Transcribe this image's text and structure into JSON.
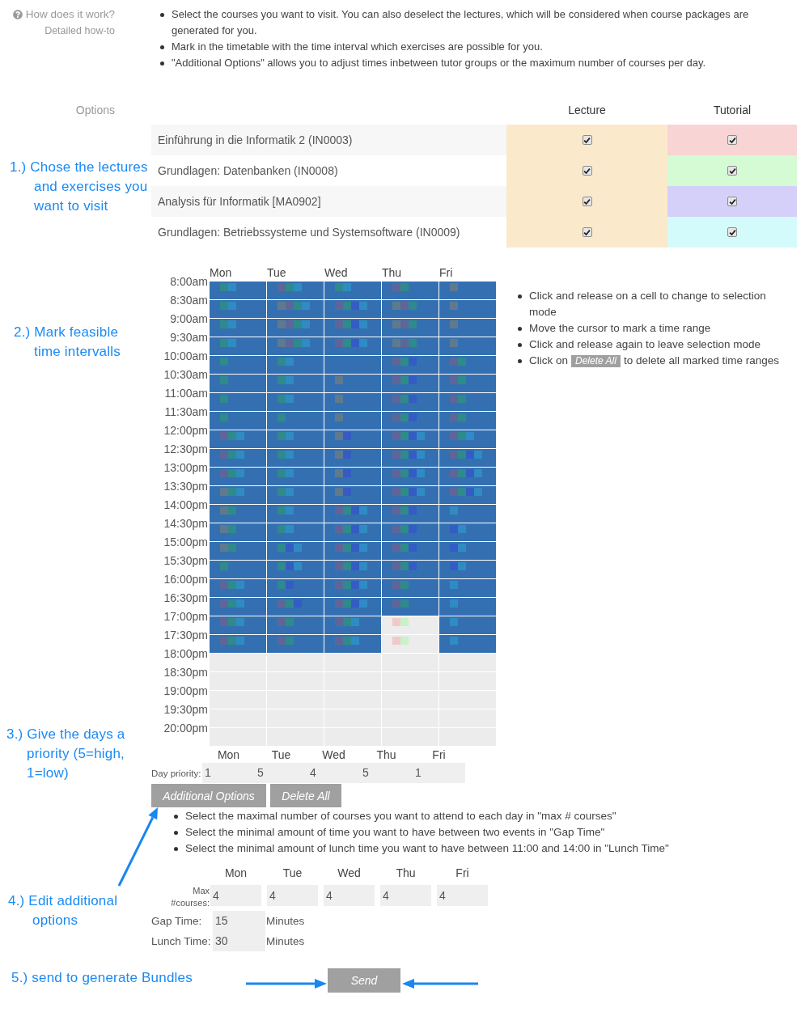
{
  "help": {
    "title": "How does it work?",
    "link": "Detailed how-to",
    "steps": [
      "Select the courses you want to visit. You can also deselect the lectures, which will be considered when course packages are generated for you.",
      "Mark in the timetable with the time interval which exercises are possible for you.",
      "\"Additional Options\" allows you to adjust times inbetween tutor groups or the maximum number of courses per day."
    ]
  },
  "courses": {
    "label": "Options",
    "annotation": "1.) Chose the lectures\nand exercises you\nwant to visit",
    "columns": [
      "Lecture",
      "Tutorial"
    ],
    "rows": [
      {
        "name": "Einführung in die Informatik 2 (IN0003)",
        "lecture": {
          "checked": true
        },
        "tutorial": {
          "checked": true,
          "color": "#f9d4d4"
        }
      },
      {
        "name": "Grundlagen: Datenbanken (IN0008)",
        "lecture": {
          "checked": true
        },
        "tutorial": {
          "checked": true,
          "color": "#d4fbd4"
        }
      },
      {
        "name": "Analysis für Informatik [MA0902]",
        "lecture": {
          "checked": true
        },
        "tutorial": {
          "checked": true,
          "color": "#d4d0fa"
        }
      },
      {
        "name": "Grundlagen: Betriebssysteme und Systemsoftware (IN0009)",
        "lecture": {
          "checked": true
        },
        "tutorial": {
          "checked": true,
          "color": "#d4fbfb"
        }
      }
    ]
  },
  "timetable": {
    "annotation": "2.) Mark feasible\ntime intervalls",
    "days": [
      "Mon",
      "Tue",
      "Wed",
      "Thu",
      "Fri"
    ],
    "rows": [
      {
        "time": "8:00am",
        "cells": [
          {
            "marked": true,
            "markers": [
              {
                "color": "#2e8a8b"
              },
              {
                "color": "#2f8bc3"
              }
            ]
          },
          {
            "marked": true,
            "markers": [
              {
                "color": "#5e6699"
              },
              {
                "color": "#2e8a8b"
              },
              {
                "color": "#2f8bc3"
              }
            ]
          },
          {
            "marked": true,
            "markers": [
              {
                "color": "#2e8a8b"
              },
              {
                "color": "#2f8bc3"
              }
            ]
          },
          {
            "marked": true,
            "markers": [
              {
                "color": "#5e6699"
              },
              {
                "color": "#2e8a8b"
              }
            ]
          },
          {
            "marked": true,
            "markers": [
              {
                "color": "#5f7a8e"
              }
            ]
          }
        ]
      },
      {
        "time": "8:30am",
        "cells": [
          {
            "marked": true,
            "markers": [
              {
                "color": "#2e8a8b"
              },
              {
                "color": "#2f8bc3"
              }
            ]
          },
          {
            "marked": true,
            "markers": [
              {
                "color": "#5f7a8e"
              },
              {
                "color": "#5e6699"
              },
              {
                "color": "#2e8a8b"
              },
              {
                "color": "#2f8bc3"
              }
            ]
          },
          {
            "marked": true,
            "markers": [
              {
                "color": "#5e6699"
              },
              {
                "color": "#2e8a8b"
              },
              {
                "color": "#345cc4"
              },
              {
                "color": "#2f8bc3"
              }
            ]
          },
          {
            "marked": true,
            "markers": [
              {
                "color": "#5f7a8e"
              },
              {
                "color": "#5e6699"
              },
              {
                "color": "#2e8a8b"
              }
            ]
          },
          {
            "marked": true,
            "markers": [
              {
                "color": "#5f7a8e"
              }
            ]
          }
        ]
      },
      {
        "time": "9:00am",
        "cells": [
          {
            "marked": true,
            "markers": [
              {
                "color": "#2e8a8b"
              },
              {
                "color": "#2f8bc3"
              }
            ]
          },
          {
            "marked": true,
            "markers": [
              {
                "color": "#5f7a8e"
              },
              {
                "color": "#5e6699"
              },
              {
                "color": "#2e8a8b"
              },
              {
                "color": "#2f8bc3"
              }
            ]
          },
          {
            "marked": true,
            "markers": [
              {
                "color": "#5e6699"
              },
              {
                "color": "#2e8a8b"
              },
              {
                "color": "#345cc4"
              },
              {
                "color": "#2f8bc3"
              }
            ]
          },
          {
            "marked": true,
            "markers": [
              {
                "color": "#5f7a8e"
              },
              {
                "color": "#5e6699"
              },
              {
                "color": "#2e8a8b"
              }
            ]
          },
          {
            "marked": true,
            "markers": [
              {
                "color": "#5f7a8e"
              }
            ]
          }
        ]
      },
      {
        "time": "9:30am",
        "cells": [
          {
            "marked": true,
            "markers": [
              {
                "color": "#2e8a8b"
              },
              {
                "color": "#2f8bc3"
              }
            ]
          },
          {
            "marked": true,
            "markers": [
              {
                "color": "#5f7a8e"
              },
              {
                "color": "#5e6699"
              },
              {
                "color": "#2e8a8b"
              },
              {
                "color": "#2f8bc3"
              }
            ]
          },
          {
            "marked": true,
            "markers": [
              {
                "color": "#5e6699"
              },
              {
                "color": "#2e8a8b"
              },
              {
                "color": "#345cc4"
              },
              {
                "color": "#2f8bc3"
              }
            ]
          },
          {
            "marked": true,
            "markers": [
              {
                "color": "#5f7a8e"
              },
              {
                "color": "#5e6699"
              },
              {
                "color": "#2e8a8b"
              }
            ]
          },
          {
            "marked": true,
            "markers": [
              {
                "color": "#5f7a8e"
              }
            ]
          }
        ]
      },
      {
        "time": "10:00am",
        "cells": [
          {
            "marked": true,
            "markers": [
              {
                "color": "#2e8a8b"
              }
            ]
          },
          {
            "marked": true,
            "markers": [
              {
                "color": "#2e8a8b"
              },
              {
                "color": "#2f8bc3"
              }
            ]
          },
          {
            "marked": true
          },
          {
            "marked": true,
            "markers": [
              {
                "color": "#5e6699"
              },
              {
                "color": "#2e8a8b"
              },
              {
                "color": "#345cc4"
              }
            ]
          },
          {
            "marked": true,
            "markers": [
              {
                "color": "#5e6699"
              },
              {
                "color": "#2e8a8b"
              }
            ]
          }
        ]
      },
      {
        "time": "10:30am",
        "cells": [
          {
            "marked": true,
            "markers": [
              {
                "color": "#2e8a8b"
              }
            ]
          },
          {
            "marked": true,
            "markers": [
              {
                "color": "#2e8a8b"
              },
              {
                "color": "#2f8bc3"
              }
            ]
          },
          {
            "marked": true,
            "markers": [
              {
                "color": "#5f7a8e"
              }
            ]
          },
          {
            "marked": true,
            "markers": [
              {
                "color": "#5e6699"
              },
              {
                "color": "#2e8a8b"
              },
              {
                "color": "#345cc4"
              }
            ]
          },
          {
            "marked": true,
            "markers": [
              {
                "color": "#5e6699"
              },
              {
                "color": "#2e8a8b"
              }
            ]
          }
        ]
      },
      {
        "time": "11:00am",
        "cells": [
          {
            "marked": true,
            "markers": [
              {
                "color": "#2e8a8b"
              }
            ]
          },
          {
            "marked": true,
            "markers": [
              {
                "color": "#2e8a8b"
              },
              {
                "color": "#2f8bc3"
              }
            ]
          },
          {
            "marked": true,
            "markers": [
              {
                "color": "#5f7a8e"
              }
            ]
          },
          {
            "marked": true,
            "markers": [
              {
                "color": "#5e6699"
              },
              {
                "color": "#2e8a8b"
              },
              {
                "color": "#345cc4"
              }
            ]
          },
          {
            "marked": true,
            "markers": [
              {
                "color": "#5e6699"
              },
              {
                "color": "#2e8a8b"
              }
            ]
          }
        ]
      },
      {
        "time": "11:30am",
        "cells": [
          {
            "marked": true,
            "markers": [
              {
                "color": "#2e8a8b"
              }
            ]
          },
          {
            "marked": true,
            "markers": [
              {
                "color": "#2e8a8b"
              }
            ]
          },
          {
            "marked": true,
            "markers": [
              {
                "color": "#5f7a8e"
              }
            ]
          },
          {
            "marked": true,
            "markers": [
              {
                "color": "#5e6699"
              },
              {
                "color": "#2e8a8b"
              },
              {
                "color": "#345cc4"
              }
            ]
          },
          {
            "marked": true,
            "markers": [
              {
                "color": "#5e6699"
              },
              {
                "color": "#2e8a8b"
              }
            ]
          }
        ]
      },
      {
        "time": "12:00pm",
        "cells": [
          {
            "marked": true,
            "markers": [
              {
                "color": "#5e6699"
              },
              {
                "color": "#2e8a8b"
              },
              {
                "color": "#2f8bc3"
              }
            ]
          },
          {
            "marked": true,
            "markers": [
              {
                "color": "#2e8a8b"
              },
              {
                "color": "#2f8bc3"
              }
            ]
          },
          {
            "marked": true,
            "markers": [
              {
                "color": "#5f7a8e"
              },
              {
                "color": "#345cc4"
              }
            ]
          },
          {
            "marked": true,
            "markers": [
              {
                "color": "#5e6699"
              },
              {
                "color": "#2e8a8b"
              },
              {
                "color": "#345cc4"
              },
              {
                "color": "#2f8bc3"
              }
            ]
          },
          {
            "marked": true,
            "markers": [
              {
                "color": "#5e6699"
              },
              {
                "color": "#2e8a8b"
              },
              {
                "color": "#2f8bc3"
              }
            ]
          }
        ]
      },
      {
        "time": "12:30pm",
        "cells": [
          {
            "marked": true,
            "markers": [
              {
                "color": "#5e6699"
              },
              {
                "color": "#2e8a8b"
              },
              {
                "color": "#2f8bc3"
              }
            ]
          },
          {
            "marked": true,
            "markers": [
              {
                "color": "#2e8a8b"
              },
              {
                "color": "#2f8bc3"
              }
            ]
          },
          {
            "marked": true,
            "markers": [
              {
                "color": "#5f7a8e"
              },
              {
                "color": "#345cc4"
              }
            ]
          },
          {
            "marked": true,
            "markers": [
              {
                "color": "#5e6699"
              },
              {
                "color": "#2e8a8b"
              },
              {
                "color": "#345cc4"
              },
              {
                "color": "#2f8bc3"
              }
            ]
          },
          {
            "marked": true,
            "markers": [
              {
                "color": "#5e6699"
              },
              {
                "color": "#2e8a8b"
              },
              {
                "color": "#345cc4"
              },
              {
                "color": "#2f8bc3"
              }
            ]
          }
        ]
      },
      {
        "time": "13:00pm",
        "cells": [
          {
            "marked": true,
            "markers": [
              {
                "color": "#5e6699"
              },
              {
                "color": "#2e8a8b"
              },
              {
                "color": "#2f8bc3"
              }
            ]
          },
          {
            "marked": true,
            "markers": [
              {
                "color": "#2e8a8b"
              },
              {
                "color": "#2f8bc3"
              }
            ]
          },
          {
            "marked": true,
            "markers": [
              {
                "color": "#5f7a8e"
              },
              {
                "color": "#345cc4"
              }
            ]
          },
          {
            "marked": true,
            "markers": [
              {
                "color": "#5e6699"
              },
              {
                "color": "#2e8a8b"
              },
              {
                "color": "#345cc4"
              },
              {
                "color": "#2f8bc3"
              }
            ]
          },
          {
            "marked": true,
            "markers": [
              {
                "color": "#5e6699"
              },
              {
                "color": "#2e8a8b"
              },
              {
                "color": "#345cc4"
              },
              {
                "color": "#2f8bc3"
              }
            ]
          }
        ]
      },
      {
        "time": "13:30pm",
        "cells": [
          {
            "marked": true,
            "markers": [
              {
                "color": "#5f7a8e"
              },
              {
                "color": "#2e8a8b"
              },
              {
                "color": "#2f8bc3"
              }
            ]
          },
          {
            "marked": true,
            "markers": [
              {
                "color": "#2e8a8b"
              },
              {
                "color": "#2f8bc3"
              }
            ]
          },
          {
            "marked": true,
            "markers": [
              {
                "color": "#5f7a8e"
              },
              {
                "color": "#345cc4"
              }
            ]
          },
          {
            "marked": true,
            "markers": [
              {
                "color": "#5e6699"
              },
              {
                "color": "#2e8a8b"
              },
              {
                "color": "#345cc4"
              },
              {
                "color": "#2f8bc3"
              }
            ]
          },
          {
            "marked": true,
            "markers": [
              {
                "color": "#5e6699"
              },
              {
                "color": "#2e8a8b"
              },
              {
                "color": "#345cc4"
              },
              {
                "color": "#2f8bc3"
              }
            ]
          }
        ]
      },
      {
        "time": "14:00pm",
        "cells": [
          {
            "marked": true,
            "markers": [
              {
                "color": "#5f7a8e"
              },
              {
                "color": "#2e8a8b"
              }
            ]
          },
          {
            "marked": true,
            "markers": [
              {
                "color": "#2e8a8b"
              },
              {
                "color": "#2f8bc3"
              }
            ]
          },
          {
            "marked": true,
            "markers": [
              {
                "color": "#5e6699"
              },
              {
                "color": "#2e8a8b"
              },
              {
                "color": "#345cc4"
              },
              {
                "color": "#2f8bc3"
              }
            ]
          },
          {
            "marked": true,
            "markers": [
              {
                "color": "#5e6699"
              },
              {
                "color": "#2e8a8b"
              },
              {
                "color": "#345cc4"
              }
            ]
          },
          {
            "marked": true,
            "markers": [
              {
                "color": "#2f8bc3"
              }
            ]
          }
        ]
      },
      {
        "time": "14:30pm",
        "cells": [
          {
            "marked": true,
            "markers": [
              {
                "color": "#5f7a8e"
              },
              {
                "color": "#2e8a8b"
              }
            ]
          },
          {
            "marked": true,
            "markers": [
              {
                "color": "#2e8a8b"
              },
              {
                "color": "#2f8bc3"
              }
            ]
          },
          {
            "marked": true,
            "markers": [
              {
                "color": "#5e6699"
              },
              {
                "color": "#2e8a8b"
              },
              {
                "color": "#345cc4"
              },
              {
                "color": "#2f8bc3"
              }
            ]
          },
          {
            "marked": true,
            "markers": [
              {
                "color": "#5e6699"
              },
              {
                "color": "#2e8a8b"
              },
              {
                "color": "#345cc4"
              }
            ]
          },
          {
            "marked": true,
            "markers": [
              {
                "color": "#345cc4"
              },
              {
                "color": "#2f8bc3"
              }
            ]
          }
        ]
      },
      {
        "time": "15:00pm",
        "cells": [
          {
            "marked": true,
            "markers": [
              {
                "color": "#5f7a8e"
              },
              {
                "color": "#2e8a8b"
              }
            ]
          },
          {
            "marked": true,
            "markers": [
              {
                "color": "#2e8a8b"
              },
              {
                "color": "#345cc4"
              },
              {
                "color": "#2f8bc3"
              }
            ]
          },
          {
            "marked": true,
            "markers": [
              {
                "color": "#5e6699"
              },
              {
                "color": "#2e8a8b"
              },
              {
                "color": "#345cc4"
              },
              {
                "color": "#2f8bc3"
              }
            ]
          },
          {
            "marked": true,
            "markers": [
              {
                "color": "#5e6699"
              },
              {
                "color": "#2e8a8b"
              },
              {
                "color": "#345cc4"
              }
            ]
          },
          {
            "marked": true,
            "markers": [
              {
                "color": "#345cc4"
              },
              {
                "color": "#2f8bc3"
              }
            ]
          }
        ]
      },
      {
        "time": "15:30pm",
        "cells": [
          {
            "marked": true,
            "markers": [
              {
                "color": "#2e8a8b"
              }
            ]
          },
          {
            "marked": true,
            "markers": [
              {
                "color": "#2e8a8b"
              },
              {
                "color": "#345cc4"
              },
              {
                "color": "#2f8bc3"
              }
            ]
          },
          {
            "marked": true,
            "markers": [
              {
                "color": "#5e6699"
              },
              {
                "color": "#2e8a8b"
              },
              {
                "color": "#345cc4"
              },
              {
                "color": "#2f8bc3"
              }
            ]
          },
          {
            "marked": true,
            "markers": [
              {
                "color": "#5e6699"
              },
              {
                "color": "#2e8a8b"
              },
              {
                "color": "#345cc4"
              }
            ]
          },
          {
            "marked": true,
            "markers": [
              {
                "color": "#345cc4"
              },
              {
                "color": "#2f8bc3"
              }
            ]
          }
        ]
      },
      {
        "time": "16:00pm",
        "cells": [
          {
            "marked": true,
            "markers": [
              {
                "color": "#5e6699"
              },
              {
                "color": "#2e8a8b"
              },
              {
                "color": "#2f8bc3"
              }
            ]
          },
          {
            "marked": true,
            "markers": [
              {
                "color": "#2e8a8b"
              },
              {
                "color": "#345cc4"
              }
            ]
          },
          {
            "marked": true,
            "markers": [
              {
                "color": "#5e6699"
              },
              {
                "color": "#2e8a8b"
              },
              {
                "color": "#345cc4"
              },
              {
                "color": "#2f8bc3"
              }
            ]
          },
          {
            "marked": true,
            "markers": [
              {
                "color": "#5e6699"
              },
              {
                "color": "#2e8a8b"
              }
            ]
          },
          {
            "marked": true,
            "markers": [
              {
                "color": "#2f8bc3"
              }
            ]
          }
        ]
      },
      {
        "time": "16:30pm",
        "cells": [
          {
            "marked": true,
            "markers": [
              {
                "color": "#5e6699"
              },
              {
                "color": "#2e8a8b"
              },
              {
                "color": "#2f8bc3"
              }
            ]
          },
          {
            "marked": true,
            "markers": [
              {
                "color": "#5e6699"
              },
              {
                "color": "#2e8a8b"
              },
              {
                "color": "#345cc4"
              }
            ]
          },
          {
            "marked": true,
            "markers": [
              {
                "color": "#5e6699"
              },
              {
                "color": "#2e8a8b"
              },
              {
                "color": "#345cc4"
              },
              {
                "color": "#2f8bc3"
              }
            ]
          },
          {
            "marked": true,
            "markers": [
              {
                "color": "#5e6699"
              },
              {
                "color": "#2e8a8b"
              }
            ]
          },
          {
            "marked": true,
            "markers": [
              {
                "color": "#2f8bc3"
              }
            ]
          }
        ]
      },
      {
        "time": "17:00pm",
        "cells": [
          {
            "marked": true,
            "markers": [
              {
                "color": "#5e6699"
              },
              {
                "color": "#2e8a8b"
              },
              {
                "color": "#2f8bc3"
              }
            ]
          },
          {
            "marked": true,
            "markers": [
              {
                "color": "#5e6699"
              },
              {
                "color": "#2e8a8b"
              }
            ]
          },
          {
            "marked": true,
            "markers": [
              {
                "color": "#5e6699"
              },
              {
                "color": "#2e8a8b"
              },
              {
                "color": "#2f8bc3"
              }
            ]
          },
          {
            "marked": false,
            "markers": [
              {
                "color": "#f2c9ca"
              },
              {
                "color": "#c8f2c8"
              }
            ]
          },
          {
            "marked": true,
            "markers": [
              {
                "color": "#2f8bc3"
              }
            ]
          }
        ]
      },
      {
        "time": "17:30pm",
        "cells": [
          {
            "marked": true,
            "markers": [
              {
                "color": "#5e6699"
              },
              {
                "color": "#2e8a8b"
              },
              {
                "color": "#2f8bc3"
              }
            ]
          },
          {
            "marked": true,
            "markers": [
              {
                "color": "#5e6699"
              },
              {
                "color": "#2e8a8b"
              }
            ]
          },
          {
            "marked": true,
            "markers": [
              {
                "color": "#5e6699"
              },
              {
                "color": "#2e8a8b"
              },
              {
                "color": "#2f8bc3"
              }
            ]
          },
          {
            "marked": false,
            "markers": [
              {
                "color": "#f2c9ca"
              },
              {
                "color": "#c8f2c8"
              }
            ]
          },
          {
            "marked": true,
            "markers": [
              {
                "color": "#2f8bc3"
              }
            ]
          }
        ]
      },
      {
        "time": "18:00pm",
        "cells": [
          {
            "marked": false
          },
          {
            "marked": false
          },
          {
            "marked": false
          },
          {
            "marked": false
          },
          {
            "marked": false
          }
        ]
      },
      {
        "time": "18:30pm",
        "cells": [
          {
            "marked": false
          },
          {
            "marked": false
          },
          {
            "marked": false
          },
          {
            "marked": false
          },
          {
            "marked": false
          }
        ]
      },
      {
        "time": "19:00pm",
        "cells": [
          {
            "marked": false
          },
          {
            "marked": false
          },
          {
            "marked": false
          },
          {
            "marked": false
          },
          {
            "marked": false
          }
        ]
      },
      {
        "time": "19:30pm",
        "cells": [
          {
            "marked": false
          },
          {
            "marked": false
          },
          {
            "marked": false
          },
          {
            "marked": false
          },
          {
            "marked": false
          }
        ]
      },
      {
        "time": "20:00pm",
        "cells": [
          {
            "marked": false
          },
          {
            "marked": false
          },
          {
            "marked": false
          },
          {
            "marked": false
          },
          {
            "marked": false
          }
        ]
      }
    ],
    "tips": [
      {
        "kind": "text",
        "text": "Click and release on a cell to change to selection mode"
      },
      {
        "kind": "text",
        "text": "Move the cursor to mark a time range"
      },
      {
        "kind": "text",
        "text": "Click and release again to leave selection mode"
      },
      {
        "kind": "badge",
        "before": "Click on",
        "badge": "Delete All",
        "after": "to delete all marked time ranges"
      }
    ]
  },
  "priority": {
    "annotation": "3.) Give the days a\npriority (5=high,\n1=low)",
    "days": [
      "Mon",
      "Tue",
      "Wed",
      "Thu",
      "Fri"
    ],
    "label": "Day priority:",
    "values": [
      "1",
      "5",
      "4",
      "5",
      "1"
    ]
  },
  "actions": [
    "Additional Options",
    "Delete All"
  ],
  "option_notes": [
    "Select the maximal number of courses you want to attend to each day in \"max # courses\"",
    "Select the minimal amount of time you want to have between two events in \"Gap Time\"",
    "Select the minimal amount of lunch time you want to have between 11:00 and 14:00 in \"Lunch Time\""
  ],
  "options": {
    "annotation": "4.) Edit additional\noptions",
    "days": [
      "Mon",
      "Tue",
      "Wed",
      "Thu",
      "Fri"
    ],
    "max_label": "Max #courses:",
    "max_values": [
      "4",
      "4",
      "4",
      "4",
      "4"
    ],
    "times": [
      {
        "label": "Gap Time:",
        "value": "15",
        "unit": "Minutes"
      },
      {
        "label": "Lunch Time:",
        "value": "30",
        "unit": "Minutes"
      }
    ]
  },
  "send": {
    "annotation": "5.) send to generate Bundles",
    "label": "Send"
  }
}
